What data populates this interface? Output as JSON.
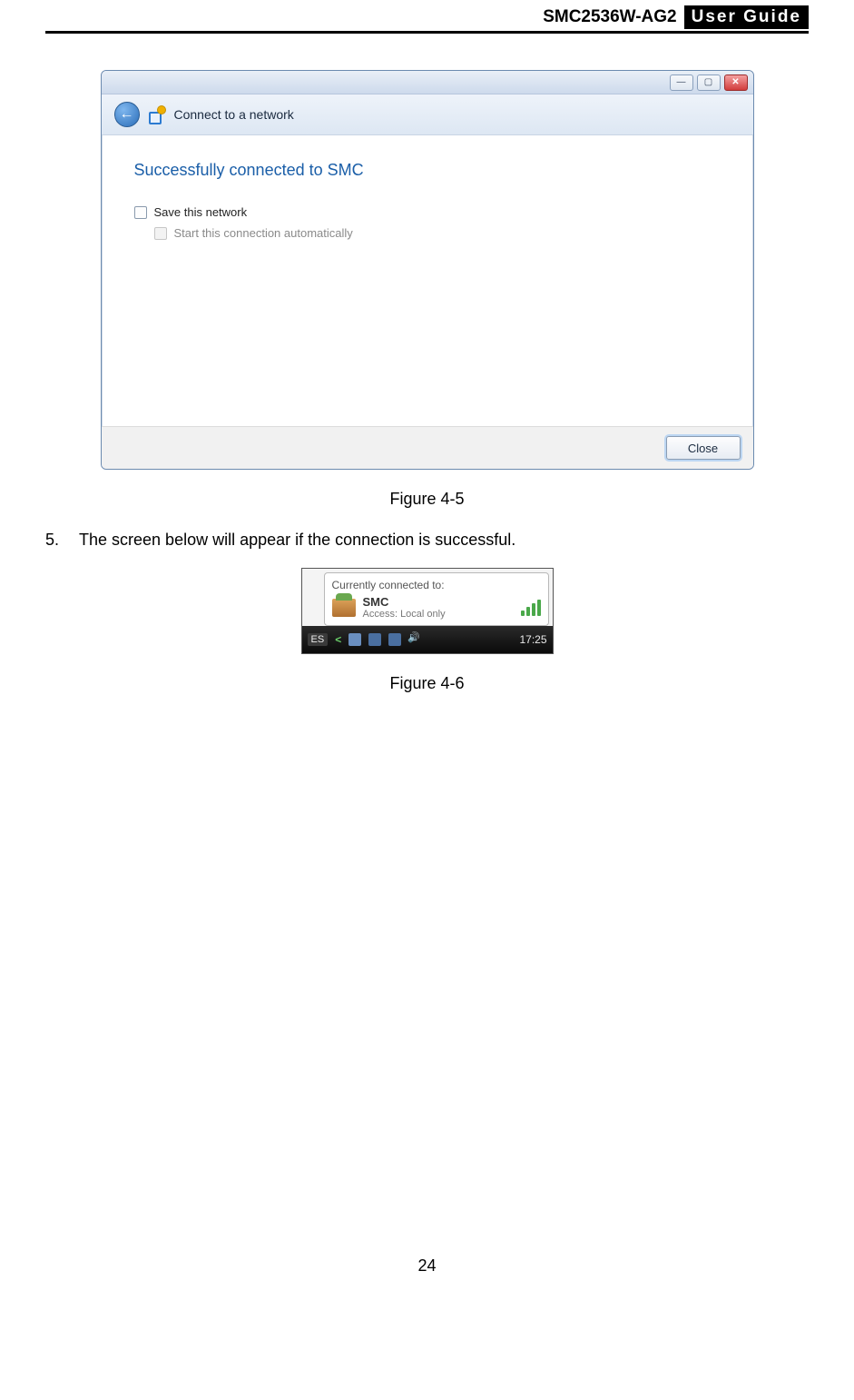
{
  "header": {
    "model": "SMC2536W-AG2",
    "guide_label": "User  Guide"
  },
  "dialog": {
    "title": "Connect to a network",
    "success_message": "Successfully connected to SMC",
    "save_label": "Save this network",
    "auto_label": "Start this connection automatically",
    "close_label": "Close"
  },
  "figure1_caption": "Figure 4-5",
  "step": {
    "number": "5.",
    "text": "The screen below will appear if the connection is successful."
  },
  "tooltip": {
    "header": "Currently connected to:",
    "network": "SMC",
    "access": "Access:  Local only"
  },
  "taskbar": {
    "lang": "ES",
    "time": "17:25"
  },
  "figure2_caption": "Figure 4-6",
  "page_number": "24"
}
